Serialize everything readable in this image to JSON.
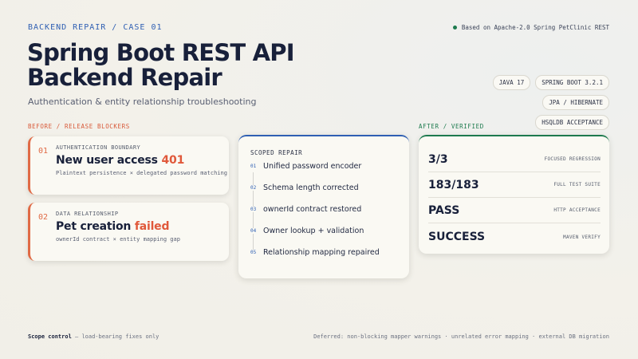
{
  "header": {
    "eyebrow": "BACKEND REPAIR / CASE 01",
    "source": "Based on Apache-2.0 Spring PetClinic REST",
    "title_line1": "Spring Boot REST API",
    "title_line2": "Backend Repair",
    "subtitle": "Authentication & entity relationship troubleshooting",
    "chips": [
      "JAVA 17",
      "SPRING BOOT 3.2.1",
      "JPA / HIBERNATE",
      "HSQLDB ACCEPTANCE"
    ]
  },
  "before": {
    "label": "BEFORE / RELEASE BLOCKERS",
    "items": [
      {
        "num": "01",
        "kicker": "AUTHENTICATION BOUNDARY",
        "headline_prefix": "New user access ",
        "headline_highlight": "401",
        "detail": "Plaintext persistence × delegated password matching"
      },
      {
        "num": "02",
        "kicker": "DATA RELATIONSHIP",
        "headline_prefix": "Pet creation ",
        "headline_highlight": "failed",
        "detail": "ownerId contract × entity mapping gap"
      }
    ]
  },
  "repair": {
    "label": "SCOPED REPAIR",
    "steps": [
      {
        "num": "01",
        "text": "Unified password encoder"
      },
      {
        "num": "02",
        "text": "Schema length corrected"
      },
      {
        "num": "03",
        "text": "ownerId contract restored"
      },
      {
        "num": "04",
        "text": "Owner lookup + validation"
      },
      {
        "num": "05",
        "text": "Relationship mapping repaired"
      }
    ]
  },
  "after": {
    "label": "AFTER / VERIFIED",
    "rows": [
      {
        "value": "3/3",
        "label": "FOCUSED REGRESSION"
      },
      {
        "value": "183/183",
        "label": "FULL TEST SUITE"
      },
      {
        "value": "PASS",
        "label": "HTTP ACCEPTANCE"
      },
      {
        "value": "SUCCESS",
        "label": "MAVEN VERIFY"
      }
    ]
  },
  "footer": {
    "scope_bold": "Scope control",
    "scope_rest": " — load-bearing fixes only",
    "deferred": "Deferred: non-blocking mapper warnings · unrelated error mapping · external DB migration"
  },
  "colors": {
    "accent_blue": "#2f5fb3",
    "accent_red": "#e0583a",
    "accent_green": "#1d7a4e",
    "ink": "#18203a"
  }
}
